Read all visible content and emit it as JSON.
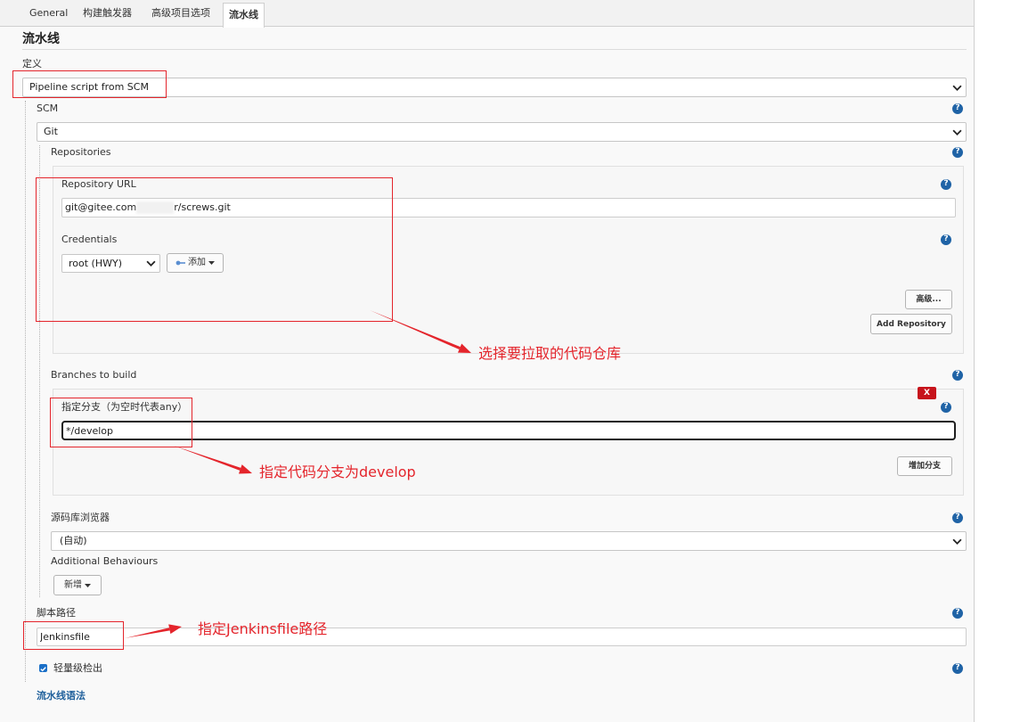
{
  "tabs": [
    {
      "label": "General",
      "active": false
    },
    {
      "label": "构建触发器",
      "active": false
    },
    {
      "label": "高级项目选项",
      "active": false
    },
    {
      "label": "流水线",
      "active": true
    }
  ],
  "section": {
    "title": "流水线"
  },
  "definition": {
    "label": "定义",
    "value": "Pipeline script from SCM"
  },
  "scm": {
    "label": "SCM",
    "value": "Git"
  },
  "repositories": {
    "label": "Repositories",
    "url_label": "Repository URL",
    "url_prefix": "git@gitee.com",
    "url_suffix": "r/screws.git",
    "credentials_label": "Credentials",
    "credentials_value": "root (HWY)",
    "add_credentials_label": "添加",
    "advanced_label": "高级...",
    "add_repository_label": "Add Repository"
  },
  "branches": {
    "label": "Branches to build",
    "delete_label": "X",
    "spec_label": "指定分支（为空时代表any）",
    "spec_value": "*/develop",
    "add_branch_label": "增加分支"
  },
  "browser": {
    "label": "源码库浏览器",
    "value": "(自动)"
  },
  "behaviours": {
    "label": "Additional Behaviours",
    "add_label": "新增"
  },
  "script_path": {
    "label": "脚本路径",
    "value": "Jenkinsfile"
  },
  "lightweight_checkout": {
    "label": "轻量级检出",
    "checked": true
  },
  "pipeline_syntax_link": "流水线语法",
  "annotations": {
    "repository_note": "选择要拉取的代码仓库",
    "branch_note": "指定代码分支为develop",
    "jenkinsfile_note": "指定Jenkinsfile路径"
  },
  "icons": {
    "help": "help-icon",
    "select_arrow": "chevron-down-icon",
    "credentials": "key-icon",
    "menu_caret": "caret-down-icon",
    "checkbox": "checkmark-icon"
  },
  "colors": {
    "annotation": "#e4252c",
    "help_icon": "#1f63a6",
    "link": "#20609c",
    "delete_button": "#c7141c",
    "checkbox": "#1a6fc7",
    "panel_background": "#f9f9f9"
  }
}
